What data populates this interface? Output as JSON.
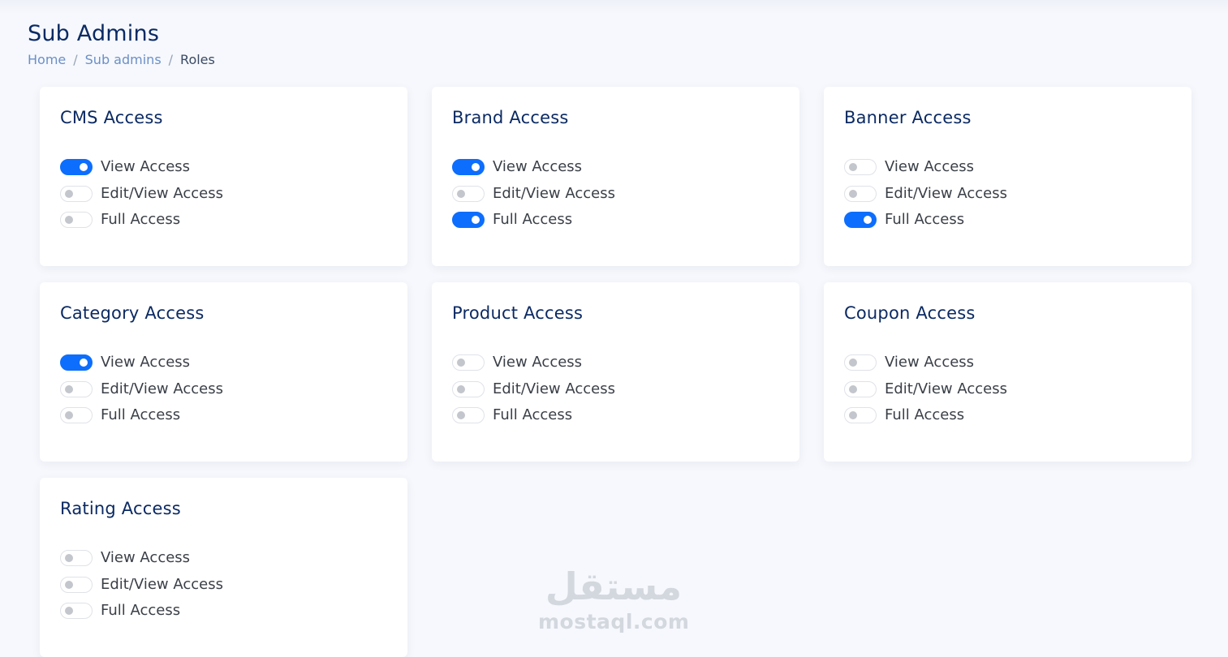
{
  "page": {
    "title": "Sub Admins"
  },
  "breadcrumb": {
    "items": [
      "Home",
      "Sub admins"
    ],
    "separator": "/",
    "current": "Roles"
  },
  "colors": {
    "accent": "#0d6efd",
    "title": "#0b2a63",
    "background": "#f6f8fd"
  },
  "cards": [
    {
      "title": "CMS Access",
      "options": [
        {
          "label": "View Access",
          "checked": true
        },
        {
          "label": "Edit/View Access",
          "checked": false
        },
        {
          "label": "Full Access",
          "checked": false
        }
      ]
    },
    {
      "title": "Brand Access",
      "options": [
        {
          "label": "View Access",
          "checked": true
        },
        {
          "label": "Edit/View Access",
          "checked": false
        },
        {
          "label": "Full Access",
          "checked": true
        }
      ]
    },
    {
      "title": "Banner Access",
      "options": [
        {
          "label": "View Access",
          "checked": false
        },
        {
          "label": "Edit/View Access",
          "checked": false
        },
        {
          "label": "Full Access",
          "checked": true
        }
      ]
    },
    {
      "title": "Category Access",
      "options": [
        {
          "label": "View Access",
          "checked": true
        },
        {
          "label": "Edit/View Access",
          "checked": false
        },
        {
          "label": "Full Access",
          "checked": false
        }
      ]
    },
    {
      "title": "Product Access",
      "options": [
        {
          "label": "View Access",
          "checked": false
        },
        {
          "label": "Edit/View Access",
          "checked": false
        },
        {
          "label": "Full Access",
          "checked": false
        }
      ]
    },
    {
      "title": "Coupon Access",
      "options": [
        {
          "label": "View Access",
          "checked": false
        },
        {
          "label": "Edit/View Access",
          "checked": false
        },
        {
          "label": "Full Access",
          "checked": false
        }
      ]
    },
    {
      "title": "Rating Access",
      "options": [
        {
          "label": "View Access",
          "checked": false
        },
        {
          "label": "Edit/View Access",
          "checked": false
        },
        {
          "label": "Full Access",
          "checked": false
        }
      ]
    }
  ],
  "watermark": {
    "arabic": "مستقل",
    "latin": "mostaql.com"
  }
}
